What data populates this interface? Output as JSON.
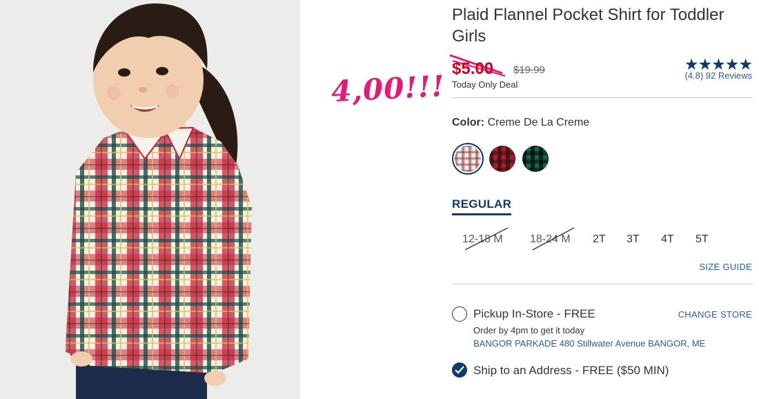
{
  "annotation": {
    "handwritten_text": "4,00!!!"
  },
  "product": {
    "title": "Plaid Flannel Pocket Shirt for Toddler Girls",
    "price": "$5.00",
    "original_price": "$19.99",
    "deal_label": "Today Only Deal",
    "rating_stars": "★★★★★",
    "reviews": "(4.8) 92 Reviews"
  },
  "color": {
    "label": "Color:",
    "value": "Creme De La Creme",
    "swatches": [
      "creme-plaid",
      "red-buffalo-plaid",
      "green-buffalo-plaid"
    ]
  },
  "fit": {
    "active_tab": "REGULAR"
  },
  "sizes": [
    {
      "label": "12-18 M",
      "available": false
    },
    {
      "label": "18-24 M",
      "available": false
    },
    {
      "label": "2T",
      "available": true
    },
    {
      "label": "3T",
      "available": true
    },
    {
      "label": "4T",
      "available": true
    },
    {
      "label": "5T",
      "available": true
    }
  ],
  "size_guide": "SIZE GUIDE",
  "fulfillment": {
    "pickup": {
      "label": "Pickup In-Store - FREE",
      "note": "Order by 4pm to get it today",
      "store": "BANGOR PARKADE 480 Stillwater Avenue  BANGOR, ME",
      "change_store": "CHANGE STORE",
      "selected": false
    },
    "ship": {
      "label": "Ship to an Address - FREE ($50 MIN)",
      "selected": true
    }
  },
  "colors": {
    "price_red": "#d0021b",
    "navy": "#0e3a6e",
    "link_blue": "#2a5ba8",
    "annotation_pink": "#e6187a"
  }
}
